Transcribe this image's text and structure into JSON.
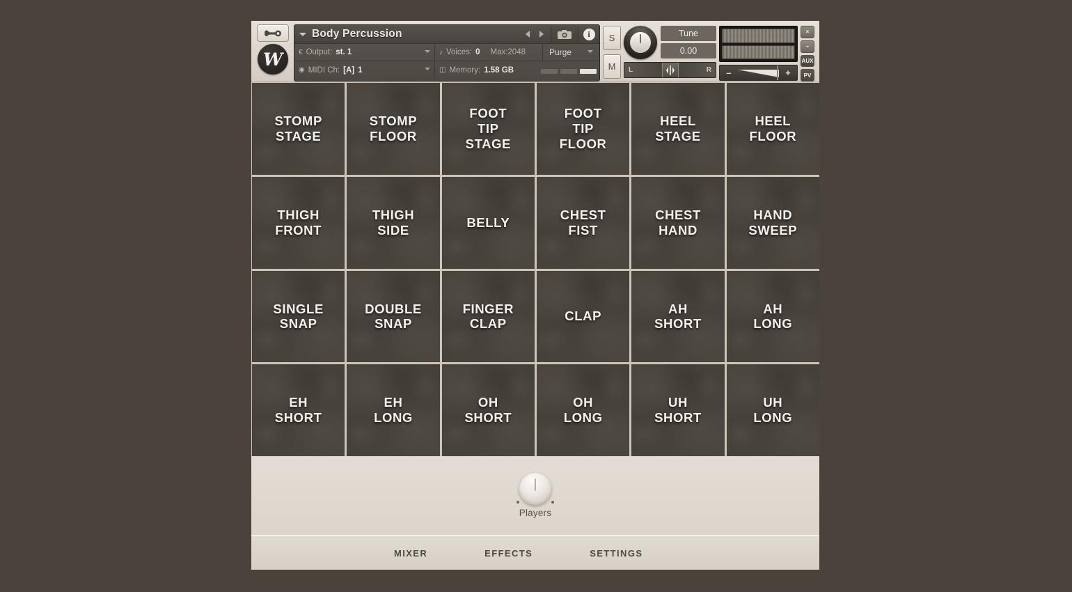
{
  "header": {
    "wrench_icon": "wrench-icon",
    "brand_logo_letter": "W",
    "instrument_name": "Body Percussion",
    "prev_icon": "previous-arrow-icon",
    "next_icon": "next-arrow-icon",
    "snapshot_icon": "camera-icon",
    "info_icon": "info-icon",
    "output_label": "Output:",
    "output_value": "st. 1",
    "midi_label": "MIDI Ch:",
    "midi_bank": "[A]",
    "midi_value": "1",
    "voices_label": "Voices:",
    "voices_value": "0",
    "max_label": "Max:2048",
    "memory_label": "Memory:",
    "memory_value": "1.58 GB",
    "purge_label": "Purge",
    "solo_label": "S",
    "mute_label": "M",
    "tune_label": "Tune",
    "tune_value": "0.00",
    "pan_left_label": "L",
    "pan_right_label": "R",
    "volume_minus": "–",
    "volume_plus": "+",
    "edge_buttons": [
      "×",
      "–",
      "AUX",
      "PV"
    ]
  },
  "grid": {
    "cells": [
      {
        "label": "STOMP\nSTAGE"
      },
      {
        "label": "STOMP\nFLOOR"
      },
      {
        "label": "FOOT\nTIP\nSTAGE"
      },
      {
        "label": "FOOT\nTIP\nFLOOR"
      },
      {
        "label": "HEEL\nSTAGE"
      },
      {
        "label": "HEEL\nFLOOR"
      },
      {
        "label": "THIGH\nFRONT"
      },
      {
        "label": "THIGH\nSIDE"
      },
      {
        "label": "BELLY"
      },
      {
        "label": "CHEST\nFIST"
      },
      {
        "label": "CHEST\nHAND"
      },
      {
        "label": "HAND\nSWEEP"
      },
      {
        "label": "SINGLE\nSNAP"
      },
      {
        "label": "DOUBLE\nSNAP"
      },
      {
        "label": "FINGER\nCLAP"
      },
      {
        "label": "CLAP"
      },
      {
        "label": "AH\nSHORT"
      },
      {
        "label": "AH\nLONG"
      },
      {
        "label": "EH\nSHORT"
      },
      {
        "label": "EH\nLONG"
      },
      {
        "label": "OH\nSHORT"
      },
      {
        "label": "OH\nLONG"
      },
      {
        "label": "UH\nSHORT"
      },
      {
        "label": "UH\nLONG"
      }
    ]
  },
  "knob_panel": {
    "players_label": "Players"
  },
  "tabs": [
    {
      "label": "MIXER"
    },
    {
      "label": "EFFECTS"
    },
    {
      "label": "SETTINGS"
    }
  ],
  "colors": {
    "cell_bg": "#46413a",
    "grid_line": "#cdc5ba",
    "panel_bg": "#ded6cd",
    "window_bg": "#4a433c",
    "text_light": "#f4f1ec"
  }
}
